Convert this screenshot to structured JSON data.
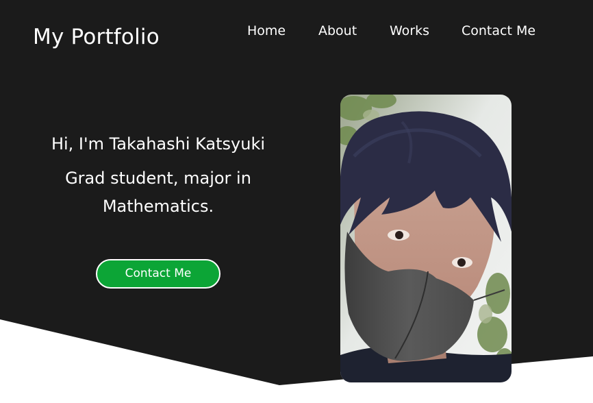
{
  "site": {
    "logo": "My Portfolio"
  },
  "nav": {
    "items": [
      "Home",
      "About",
      "Works",
      "Contact Me"
    ]
  },
  "hero": {
    "greeting": "Hi, I'm Takahashi Katsyuki",
    "role": "Grad student, major in Mathematics.",
    "cta_label": "Contact Me",
    "profile_photo": "selfie with black face mask"
  },
  "colors": {
    "hero_background": "#1b1b1b",
    "text": "#ffffff",
    "cta_background": "#0ca536",
    "page_background": "#ffffff"
  }
}
